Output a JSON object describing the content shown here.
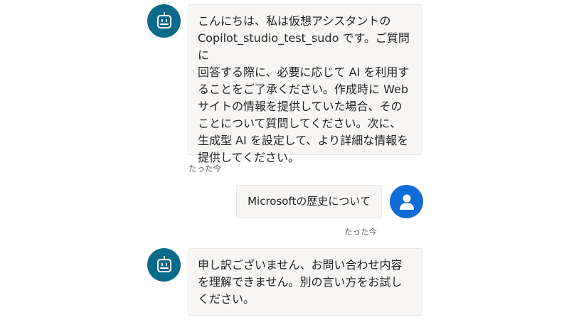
{
  "messages": [
    {
      "role": "bot",
      "avatar_icon": "bot-icon",
      "text": "こんにちは、私は仮想アシスタントの\nCopilot_studio_test_sudo です。ご質問に\n回答する際に、必要に応じて AI を利用す\nることをご了承ください。作成時に Web\nサイトの情報を提供していた場合、その\nことについて質問してください。次に、\n生成型 AI を設定して、より詳細な情報を\n提供してください。",
      "timestamp": "たった今"
    },
    {
      "role": "user",
      "avatar_icon": "person-icon",
      "text": "Microsoftの歴史について",
      "timestamp": "たった今"
    },
    {
      "role": "bot",
      "avatar_icon": "bot-icon",
      "text": "申し訳ございません、お問い合わせ内容\nを理解できません。別の言い方をお試し\nください。",
      "timestamp": ""
    }
  ],
  "colors": {
    "bot_avatar": "#0b6a8a",
    "user_avatar": "#0f6cd6",
    "bubble_bg": "#f7f6f5"
  }
}
